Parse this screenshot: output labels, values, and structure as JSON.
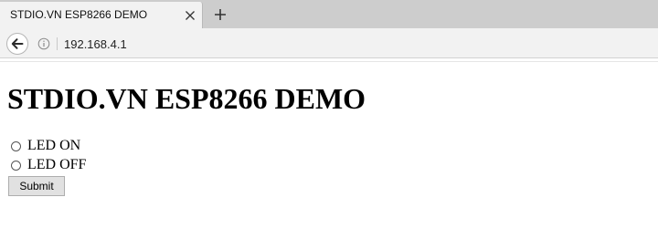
{
  "browser": {
    "tab_title": "STDIO.VN ESP8266 DEMO",
    "address": "192.168.4.1",
    "icons": {
      "back": "back-arrow-icon",
      "info": "info-icon",
      "close": "close-icon",
      "new_tab": "plus-icon"
    }
  },
  "page": {
    "heading": "STDIO.VN ESP8266 DEMO",
    "form": {
      "options": [
        {
          "label": "LED ON",
          "checked": false
        },
        {
          "label": "LED OFF",
          "checked": false
        }
      ],
      "submit_label": "Submit"
    }
  },
  "colors": {
    "tabstrip": "#cdcdcd",
    "tab_active": "#f2f2f2",
    "toolbar": "#f2f2f2",
    "page_background": "#ffffff"
  }
}
